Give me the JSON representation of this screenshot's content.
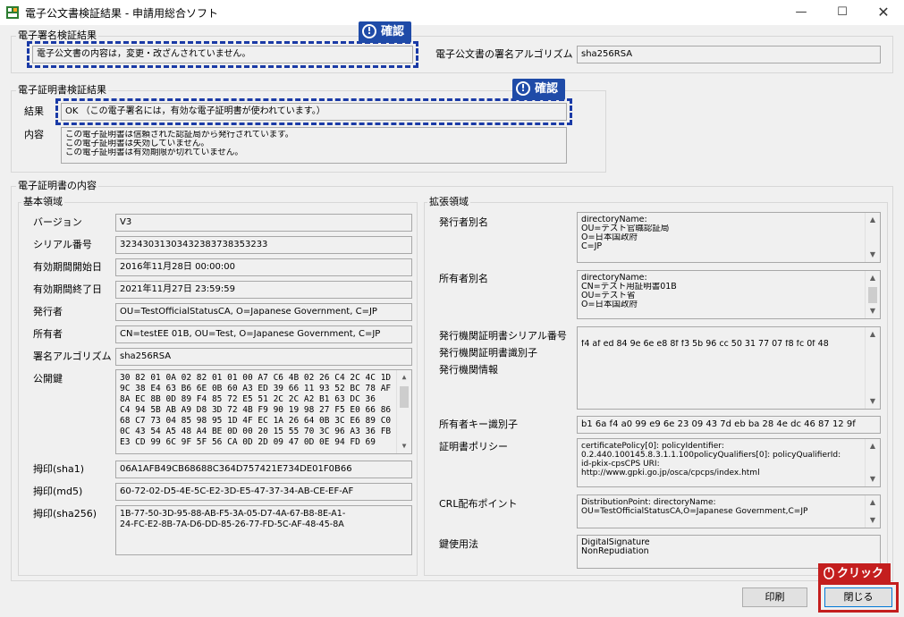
{
  "window": {
    "title": "電子公文書検証結果 - 申請用総合ソフト",
    "minimize_glyph": "—",
    "maximize_glyph": "☐",
    "close_glyph": "✕"
  },
  "signature_section": {
    "label": "電子署名検証結果",
    "result": "電子公文書の内容は，変更・改ざんされていません。",
    "algorithm_label": "電子公文書の署名アルゴリズム",
    "algorithm_value": "sha256RSA"
  },
  "cert_verify_section": {
    "label": "電子証明書検証結果",
    "result_label": "結果",
    "result_value": "OK （この電子署名には，有効な電子証明書が使われています。）",
    "content_label": "内容",
    "content_lines": [
      "この電子証明書は信頼された認証局から発行されています。",
      "この電子証明書は失効していません。",
      "この電子証明書は有効期限が切れていません。"
    ]
  },
  "cert_content": {
    "label": "電子証明書の内容",
    "basic": {
      "label": "基本領域",
      "version_label": "バージョン",
      "version": "V3",
      "serial_label": "シリアル番号",
      "serial": "32343031303432383738353233",
      "valid_from_label": "有効期間開始日",
      "valid_from": "2016年11月28日  00:00:00",
      "valid_to_label": "有効期間終了日",
      "valid_to": "2021年11月27日  23:59:59",
      "issuer_label": "発行者",
      "issuer": "OU=TestOfficialStatusCA, O=Japanese Government, C=JP",
      "subject_label": "所有者",
      "subject": "CN=testEE 01B, OU=Test, O=Japanese Government, C=JP",
      "sig_alg_label": "署名アルゴリズム",
      "sig_alg": "sha256RSA",
      "pubkey_label": "公開鍵",
      "pubkey_lines": [
        "30 82 01 0A 02 82 01 01 00 A7 C6 4B 02 26 C4 2C 4C 1D",
        "9C 38 E4 63 B6 6E 0B 60 A3 ED 39 66 11 93 52 BC 78 AF",
        "8A EC 8B 0D 89 F4 85 72 E5 51 2C 2C A2 B1 63 DC 36",
        "C4 94 5B AB A9 D8 3D 72 4B F9 90 19 98 27 F5 E0 66 86",
        "68 C7 73 04 85 98 95 1D 4F EC 1A 26 64 0B 3C E6 89 C0",
        "0C 43 54 A5 48 A4 BE 0D 00 20 15 55 70 3C 96 A3 36 FB",
        "E3 CD 99 6C 9F 5F 56 CA 0D 2D 09 47 0D 0E 94 FD 69"
      ],
      "sha1_label": "拇印(sha1)",
      "sha1": "06A1AFB49CB68688C364D757421E734DE01F0B66",
      "md5_label": "拇印(md5)",
      "md5": "60-72-02-D5-4E-5C-E2-3D-E5-47-37-34-AB-CE-EF-AF",
      "sha256_label": "拇印(sha256)",
      "sha256_lines": [
        "1B-77-50-3D-95-88-AB-F5-3A-05-D7-4A-67-B8-8E-A1-",
        "24-FC-E2-8B-7A-D6-DD-85-26-77-FD-5C-AF-48-45-8A"
      ]
    },
    "ext": {
      "label": "拡張領域",
      "issuer_alt_label": "発行者別名",
      "issuer_alt_lines": [
        "directoryName:",
        "OU=テスト官職認証局",
        "O=日本国政府",
        "C=JP"
      ],
      "subject_alt_label": "所有者別名",
      "subject_alt_lines": [
        "directoryName:",
        "CN=テスト用証明書01B",
        "OU=テスト省",
        "O=日本国政府"
      ],
      "issuer_serial_label": "発行機関証明書シリアル番号",
      "issuer_id_label": "発行機関証明書識別子",
      "issuer_info_label": "発行機関情報",
      "authority_key_id": "f4 af ed 84 9e 6e e8 8f f3 5b 96 cc 50 31 77 07 f8 fc 0f 48",
      "subject_key_id_label": "所有者キー識別子",
      "subject_key_id": "b1 6a f4 a0 99 e9 6e 23 09 43 7d eb ba 28 4e dc 46 87 12 9f",
      "policy_label": "証明書ポリシー",
      "policy_lines": [
        "certificatePolicy[0]: policyIdentifier:",
        "0.2.440.100145.8.3.1.1.100policyQualifiers[0]: policyQualifierId:",
        "id-pkix-cpsCPS URI:",
        "http://www.gpki.go.jp/osca/cpcps/index.html"
      ],
      "crl_label": "CRL配布ポイント",
      "crl_lines": [
        "DistributionPoint: directoryName:",
        "OU=TestOfficialStatusCA,O=Japanese Government,C=JP"
      ],
      "key_usage_label": "鍵使用法",
      "key_usage_lines": [
        "DigitalSignature",
        "NonRepudiation"
      ]
    }
  },
  "buttons": {
    "print": "印刷",
    "close": "閉じる"
  },
  "callouts": {
    "confirm": "確認",
    "click": "クリック"
  },
  "colors": {
    "callout_blue": "#1f4ba8",
    "callout_red": "#c41e1e"
  }
}
